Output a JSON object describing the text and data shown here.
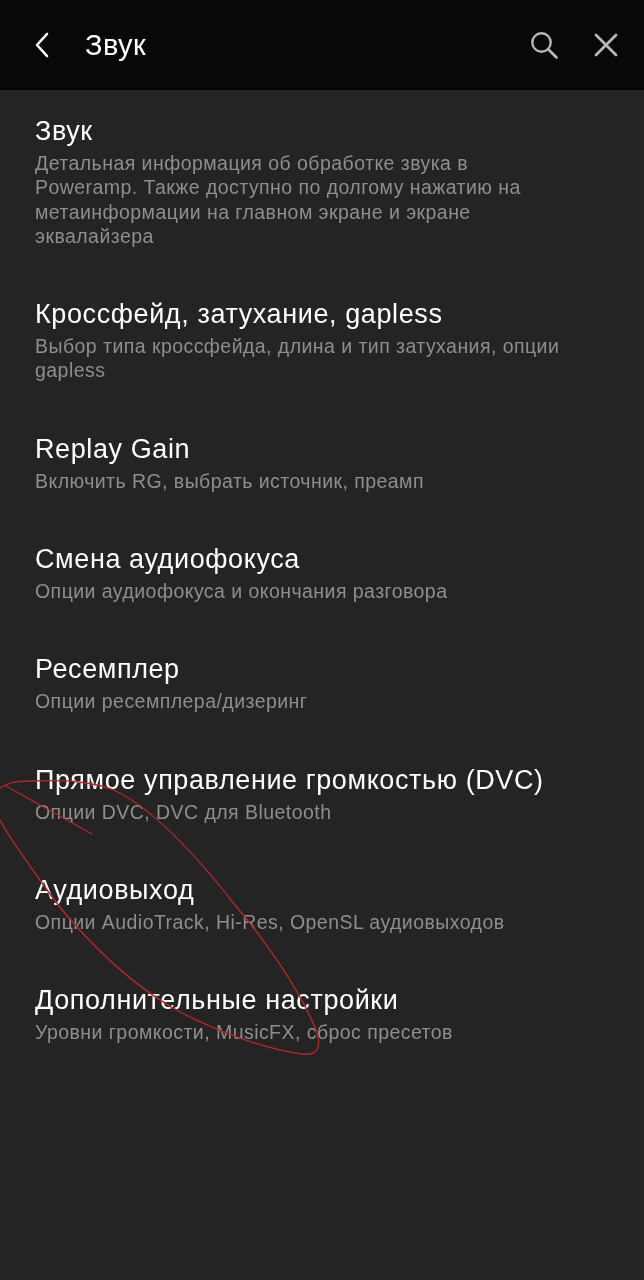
{
  "toolbar": {
    "title": "Звук"
  },
  "items": [
    {
      "title": "Звук",
      "summary": "Детальная информация об обработке звука в Poweramp. Также доступно по долгому нажатию на метаинформации на главном экране и экране эквалайзера"
    },
    {
      "title": "Кроссфейд, затухание, gapless",
      "summary": "Выбор типа кроссфейда, длина и тип затухания, опции gapless"
    },
    {
      "title": "Replay Gain",
      "summary": "Включить RG, выбрать источник, преамп"
    },
    {
      "title": "Смена аудиофокуса",
      "summary": "Опции аудиофокуса и окончания разговора"
    },
    {
      "title": "Ресемплер",
      "summary": "Опции ресемплера/дизеринг"
    },
    {
      "title": "Прямое управление громкостью (DVC)",
      "summary": "Опции DVC, DVC для Bluetooth"
    },
    {
      "title": "Аудиовыход",
      "summary": "Опции AudioTrack, Hi-Res, OpenSL аудиовыходов"
    },
    {
      "title": "Дополнительные настройки",
      "summary": "Уровни громкости, MusicFX, сброс пресетов"
    }
  ]
}
